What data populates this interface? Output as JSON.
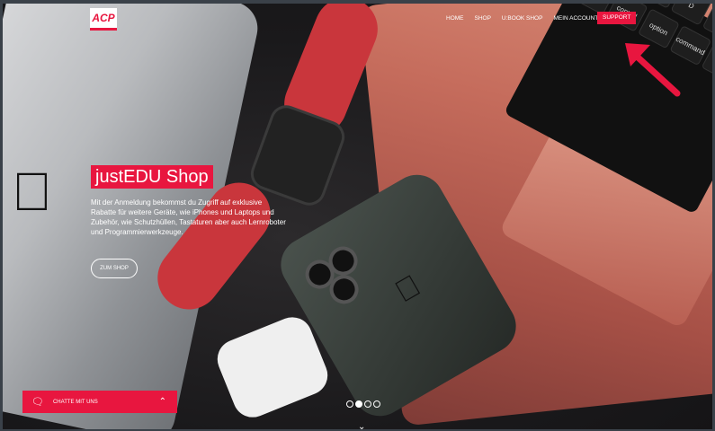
{
  "brand": {
    "logo_text": "ACP"
  },
  "nav": {
    "items": [
      "HOME",
      "SHOP",
      "U:BOOK SHOP",
      "MEIN ACCOUNT"
    ],
    "support_label": "SUPPORT"
  },
  "hero": {
    "title": "justEDU Shop",
    "description": "Mit der Anmeldung bekommst du Zugriff auf exklusive Rabatte für weitere Geräte, wie iPhones und Laptops und Zubehör, wie Schutzhüllen, Tastaturen aber auch Lernroboter und Programmierwerkzeuge.",
    "button_label": "ZUM SHOP"
  },
  "carousel": {
    "slide_count": 4,
    "active_index": 1
  },
  "chat": {
    "label": "CHATTE MIT UNS",
    "icon": "chat-bubbles-icon"
  },
  "colors": {
    "accent": "#e8163f"
  }
}
